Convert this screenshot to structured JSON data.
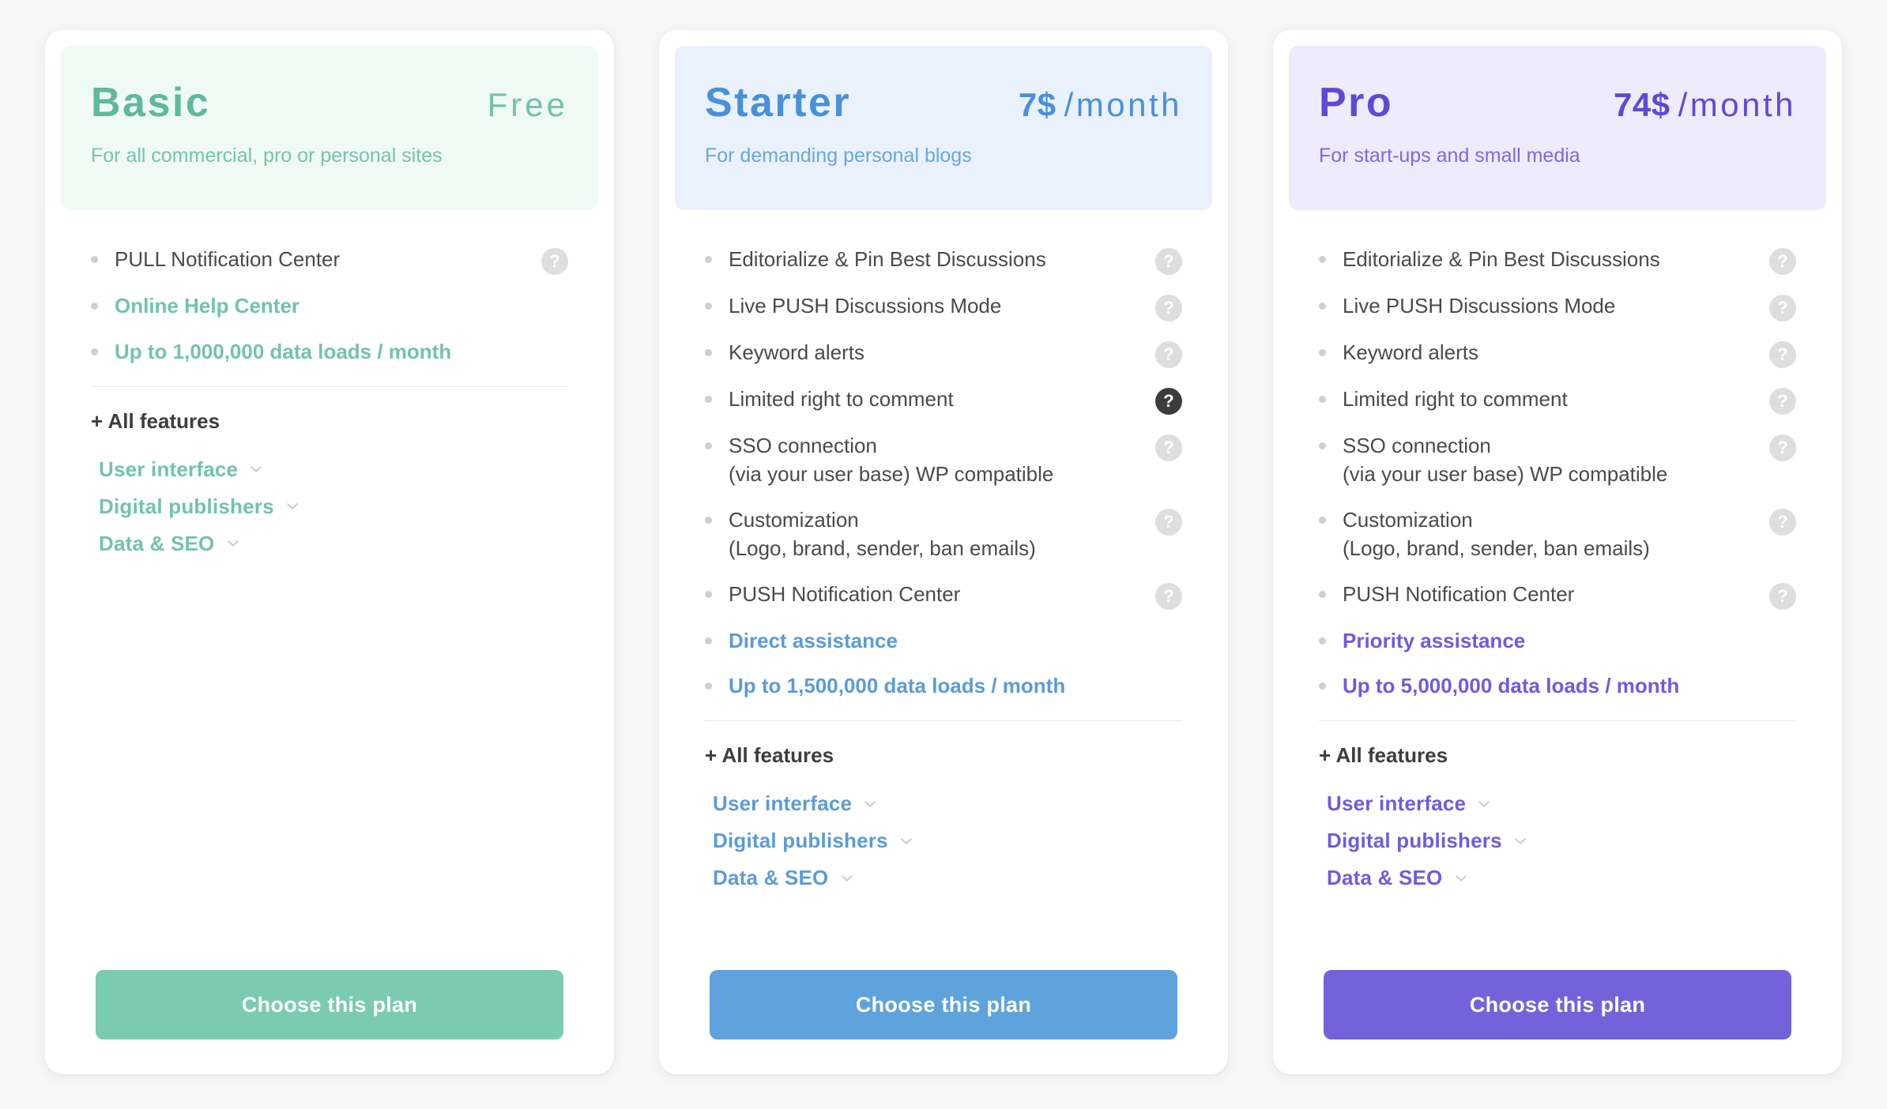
{
  "page": {
    "background": "#f7f7f8"
  },
  "plans": [
    {
      "id": "basic",
      "name": "Basic",
      "price": "Free",
      "period": "",
      "tagline": "For all commercial, pro or personal sites",
      "accent": "#72c4a7",
      "header_bg": "#effaf5",
      "name_color": "#5fb99c",
      "price_color": "#73c2a8",
      "tagline_color": "#77c3a9",
      "highlight_color": "#72c4a7",
      "button_color": "#7acbb0",
      "button_label": "Choose this plan",
      "all_features_label": "+ All features",
      "features": [
        {
          "text": "PULL Notification Center",
          "sub": "",
          "highlight": false,
          "help": true,
          "help_active": false
        },
        {
          "text": "Online Help Center",
          "sub": "",
          "highlight": true,
          "help": false,
          "help_active": false
        },
        {
          "text": "Up to 1,000,000 data loads / month",
          "sub": "",
          "highlight": true,
          "help": false,
          "help_active": false
        }
      ],
      "accordion": [
        {
          "label": "User interface"
        },
        {
          "label": "Digital publishers"
        },
        {
          "label": "Data & SEO"
        }
      ]
    },
    {
      "id": "starter",
      "name": "Starter",
      "price": "7$",
      "period": "/month",
      "tagline": "For demanding personal blogs",
      "accent": "#5b9bd8",
      "header_bg": "#e9f2fc",
      "name_color": "#4a90d9",
      "price_color": "#4a90d9",
      "tagline_color": "#6aa6de",
      "highlight_color": "#5b9bd8",
      "button_color": "#5fa3dd",
      "button_label": "Choose this plan",
      "all_features_label": "+ All features",
      "features": [
        {
          "text": "Editorialize & Pin Best Discussions",
          "sub": "",
          "highlight": false,
          "help": true,
          "help_active": false
        },
        {
          "text": "Live PUSH Discussions Mode",
          "sub": "",
          "highlight": false,
          "help": true,
          "help_active": false
        },
        {
          "text": "Keyword alerts",
          "sub": "",
          "highlight": false,
          "help": true,
          "help_active": false
        },
        {
          "text": "Limited right to comment",
          "sub": "",
          "highlight": false,
          "help": true,
          "help_active": true
        },
        {
          "text": "SSO connection",
          "sub": "(via your user base) WP compatible",
          "highlight": false,
          "help": true,
          "help_active": false
        },
        {
          "text": "Customization",
          "sub": "(Logo, brand, sender, ban emails)",
          "highlight": false,
          "help": true,
          "help_active": false
        },
        {
          "text": "PUSH Notification Center",
          "sub": "",
          "highlight": false,
          "help": true,
          "help_active": false
        },
        {
          "text": "Direct assistance",
          "sub": "",
          "highlight": true,
          "help": false,
          "help_active": false
        },
        {
          "text": "Up to 1,500,000 data loads / month",
          "sub": "",
          "highlight": true,
          "help": false,
          "help_active": false
        }
      ],
      "accordion": [
        {
          "label": "User interface"
        },
        {
          "label": "Digital publishers"
        },
        {
          "label": "Data & SEO"
        }
      ]
    },
    {
      "id": "pro",
      "name": "Pro",
      "price": "74$",
      "period": "/month",
      "tagline": "For start-ups and small media",
      "accent": "#6c5ce0",
      "header_bg": "#eeebfc",
      "name_color": "#5d4bd6",
      "price_color": "#5d4bd6",
      "tagline_color": "#7a6ae0",
      "highlight_color": "#6c5ce0",
      "button_color": "#7363da",
      "button_label": "Choose this plan",
      "all_features_label": "+ All features",
      "features": [
        {
          "text": "Editorialize & Pin Best Discussions",
          "sub": "",
          "highlight": false,
          "help": true,
          "help_active": false
        },
        {
          "text": "Live PUSH Discussions Mode",
          "sub": "",
          "highlight": false,
          "help": true,
          "help_active": false
        },
        {
          "text": "Keyword alerts",
          "sub": "",
          "highlight": false,
          "help": true,
          "help_active": false
        },
        {
          "text": "Limited right to comment",
          "sub": "",
          "highlight": false,
          "help": true,
          "help_active": false
        },
        {
          "text": "SSO connection",
          "sub": "(via your user base) WP compatible",
          "highlight": false,
          "help": true,
          "help_active": false
        },
        {
          "text": "Customization",
          "sub": "(Logo, brand, sender, ban emails)",
          "highlight": false,
          "help": true,
          "help_active": false
        },
        {
          "text": "PUSH Notification Center",
          "sub": "",
          "highlight": false,
          "help": true,
          "help_active": false
        },
        {
          "text": "Priority assistance",
          "sub": "",
          "highlight": true,
          "help": false,
          "help_active": false
        },
        {
          "text": "Up to 5,000,000 data loads / month",
          "sub": "",
          "highlight": true,
          "help": false,
          "help_active": false
        }
      ],
      "accordion": [
        {
          "label": "User interface"
        },
        {
          "label": "Digital publishers"
        },
        {
          "label": "Data & SEO"
        }
      ]
    }
  ],
  "icons": {
    "help": "?",
    "chevron_down": "chevron-down-icon"
  }
}
